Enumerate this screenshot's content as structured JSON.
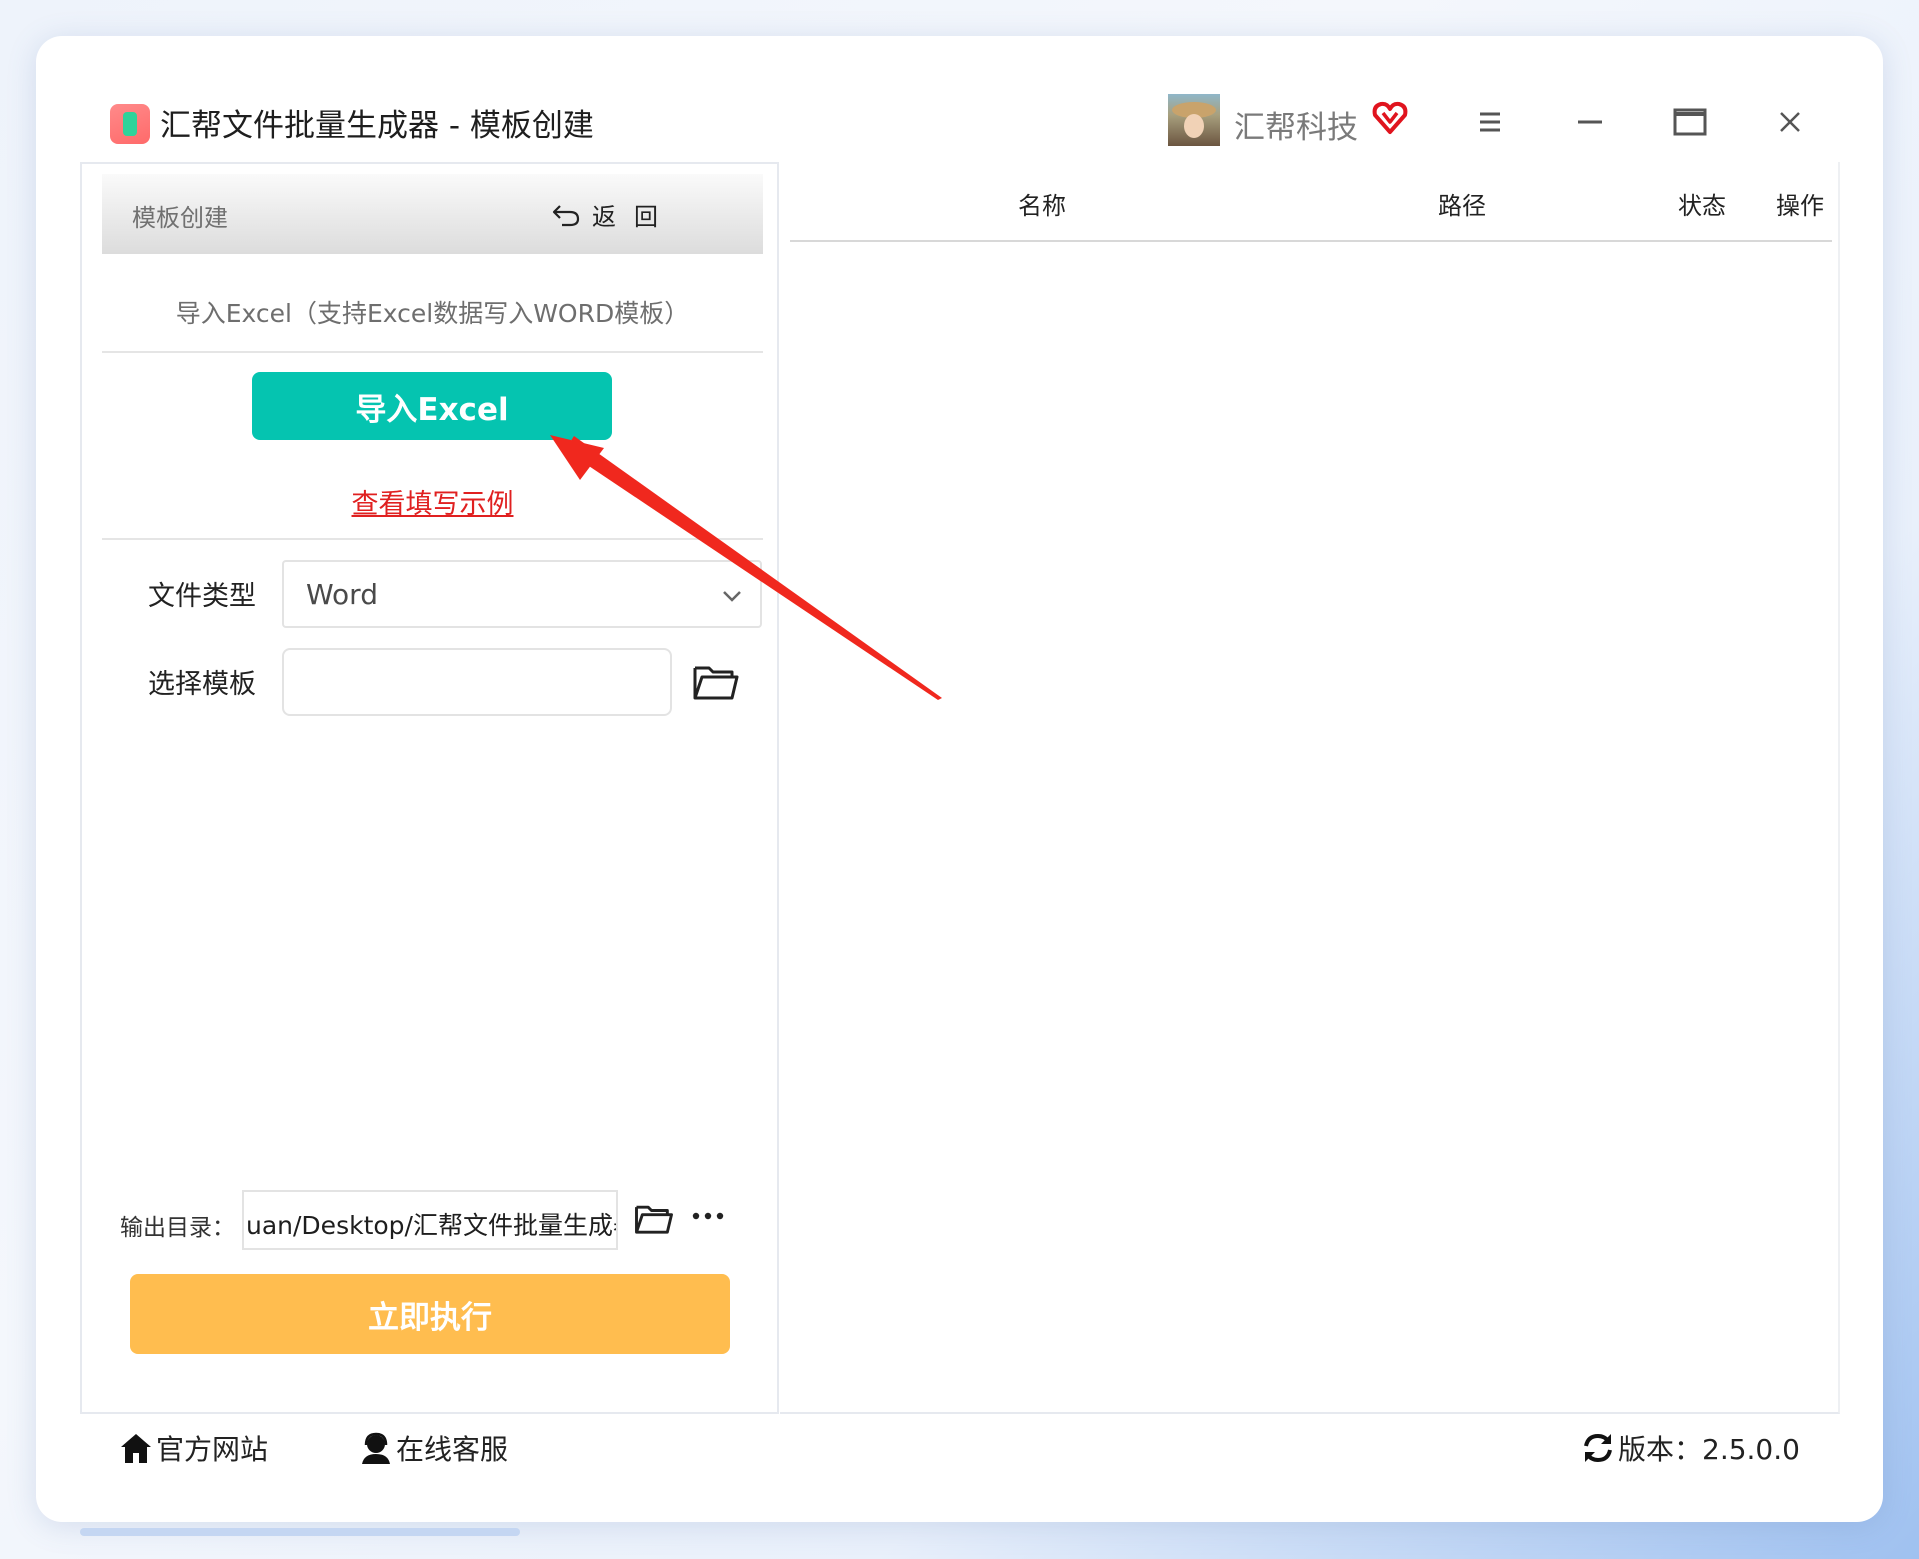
{
  "window": {
    "title": "汇帮文件批量生成器 - 模板创建",
    "company": "汇帮科技",
    "icons": [
      "app-icon",
      "avatar",
      "vip-heart-icon",
      "menu-icon",
      "minimize-icon",
      "maximize-icon",
      "close-icon"
    ]
  },
  "panel": {
    "header_title": "模板创建",
    "back_label": "返回",
    "import_hint": "导入Excel（支持Excel数据写入WORD模板）",
    "import_button": "导入Excel",
    "example_link": "查看填写示例",
    "file_type_label": "文件类型",
    "file_type_value": "Word",
    "template_label": "选择模板",
    "template_value": "",
    "output_label": "输出目录：",
    "output_value": "uan/Desktop/汇帮文件批量生成器",
    "run_button": "立即执行"
  },
  "table": {
    "columns": [
      "名称",
      "路径",
      "状态",
      "操作"
    ],
    "rows": []
  },
  "footer": {
    "website": "官方网站",
    "support": "在线客服",
    "version": "版本：2.5.0.0"
  },
  "colors": {
    "import_button": "#05c4b0",
    "run_button": "#ffbd4f",
    "link": "#e02020",
    "annotation_arrow": "#f0281e"
  }
}
